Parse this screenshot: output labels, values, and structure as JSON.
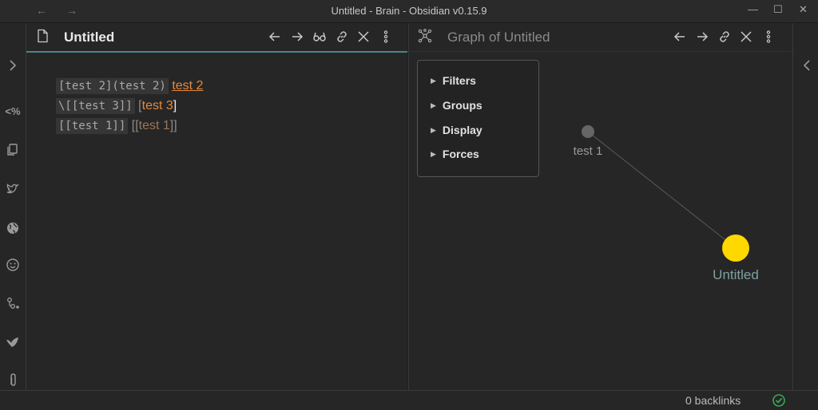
{
  "window": {
    "title": "Untitled - Brain - Obsidian v0.15.9",
    "back_icon": "←",
    "forward_icon": "→",
    "minimize_icon": "—",
    "maximize_icon": "☐",
    "close_icon": "✕"
  },
  "ribbon": {
    "items": [
      "expand-sidebar",
      "percent-tag",
      "files",
      "twitter-bird",
      "globe",
      "emoji-smile",
      "graph-nodes",
      "bird",
      "paperclip"
    ],
    "percent_label": "<%"
  },
  "left_pane": {
    "title": "Untitled",
    "toolbar": [
      "back",
      "forward",
      "reading-view",
      "link",
      "close",
      "more-options"
    ],
    "lines": [
      {
        "code": "[test 2](test 2)",
        "link": "test 2"
      },
      {
        "code": "\\[[test 3]]",
        "open_bracket": "[",
        "link": "test 3",
        "close_bracket": "]"
      },
      {
        "code": "[[test 1]]",
        "open_bracket": "[[",
        "link": "test 1",
        "close_bracket": "]]"
      }
    ]
  },
  "right_pane": {
    "title": "Graph of Untitled",
    "toolbar": [
      "back",
      "forward",
      "link",
      "close",
      "more-options"
    ],
    "controls": [
      "Filters",
      "Groups",
      "Display",
      "Forces"
    ],
    "nodes": [
      {
        "label": "test 1",
        "color": "#666666"
      },
      {
        "label": "Untitled",
        "color": "#ffd800"
      }
    ],
    "edge_color": "#5a5a5a"
  },
  "status_bar": {
    "backlinks": "0 backlinks",
    "sync_color": "#3aa757"
  },
  "colors": {
    "accent": "#48868a",
    "link": "#e8883b",
    "link_dim": "#9c7452"
  }
}
